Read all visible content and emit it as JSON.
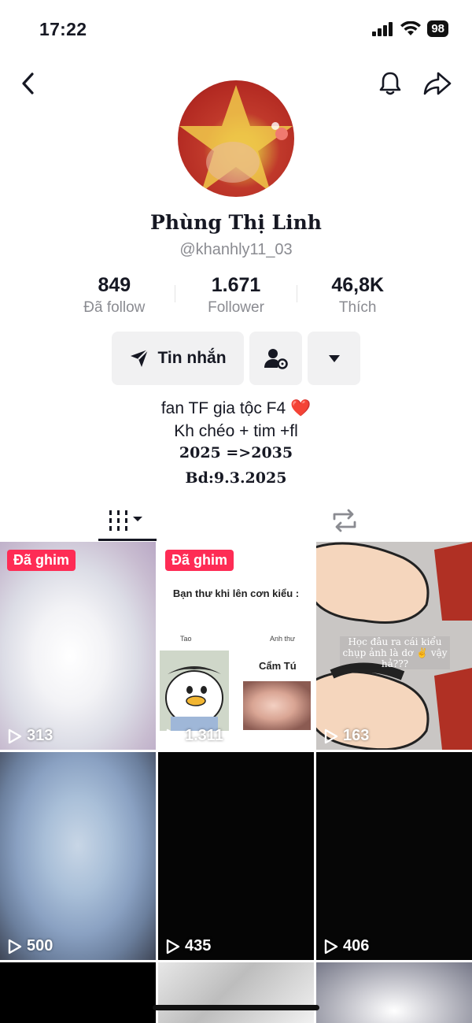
{
  "status_bar": {
    "time": "17:22",
    "battery": "98"
  },
  "profile": {
    "display_name": "Phùng Thị Linh",
    "username": "@khanhly11_03"
  },
  "stats": [
    {
      "value": "849",
      "label": "Đã follow"
    },
    {
      "value": "1.671",
      "label": "Follower"
    },
    {
      "value": "46,8K",
      "label": "Thích"
    }
  ],
  "actions": {
    "message_label": "Tin nhắn"
  },
  "bio": {
    "line1": "fan TF gia tộc F4 ❤️",
    "line2": "Kh chéo + tim +fl",
    "line3": "2025 =>2035",
    "line4": "Bd:9.3.2025"
  },
  "videos": [
    {
      "pinned_label": "Đã ghim",
      "views": "313"
    },
    {
      "pinned_label": "Đã ghim",
      "views": "1.311",
      "meme_title": "Bạn thư khi lên cơn kiểu :",
      "meme_left": "Tao",
      "meme_right": "Anh thư",
      "meme_name": "Cẩm Tú"
    },
    {
      "views": "163",
      "caption": "Học đâu ra cái kiểu chụp ảnh là dơ ✌️ vậy hả???"
    },
    {
      "views": "500"
    },
    {
      "views": "435"
    },
    {
      "views": "406"
    }
  ],
  "colors": {
    "accent": "#fe2c55",
    "text": "#161823",
    "muted": "#8a8b91",
    "button_bg": "#f1f1f2"
  },
  "icons": [
    "back-icon",
    "bell-icon",
    "share-icon",
    "send-icon",
    "add-friend-settings-icon",
    "dropdown-icon",
    "grid-icon",
    "repost-icon",
    "play-icon"
  ]
}
